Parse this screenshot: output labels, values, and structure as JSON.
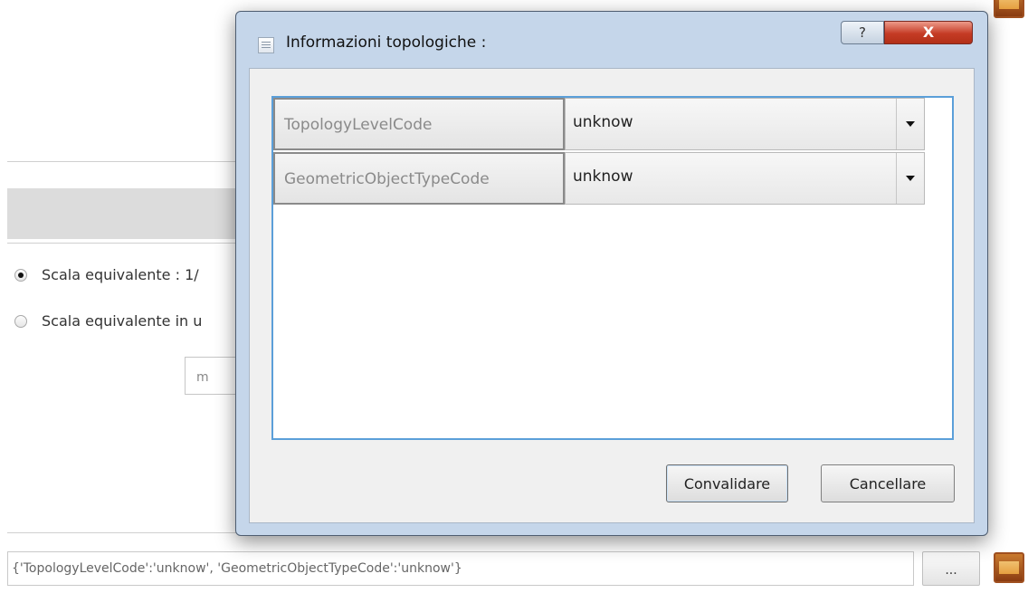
{
  "background": {
    "radio_options": [
      {
        "label": "Scala equivalente :  1/",
        "checked": true
      },
      {
        "label": "Scala equivalente in u",
        "checked": false
      }
    ],
    "unit_value": "m",
    "topology_field_value": "{'TopologyLevelCode':'unknow', 'GeometricObjectTypeCode':'unknow'}",
    "browse_button_label": "...",
    "map_icon": "map-icon"
  },
  "dialog": {
    "title": "Informazioni topologiche :",
    "title_icon": "document-icon",
    "help_label": "?",
    "close_label": "X",
    "rows": [
      {
        "label": "TopologyLevelCode",
        "value": "unknow"
      },
      {
        "label": "GeometricObjectTypeCode",
        "value": "unknow"
      }
    ],
    "ok_label": "Convalidare",
    "cancel_label": "Cancellare"
  },
  "colors": {
    "dialog_frame": "#c5d6ea",
    "close_button": "#c53b25",
    "grid_border": "#5b9fd9"
  }
}
